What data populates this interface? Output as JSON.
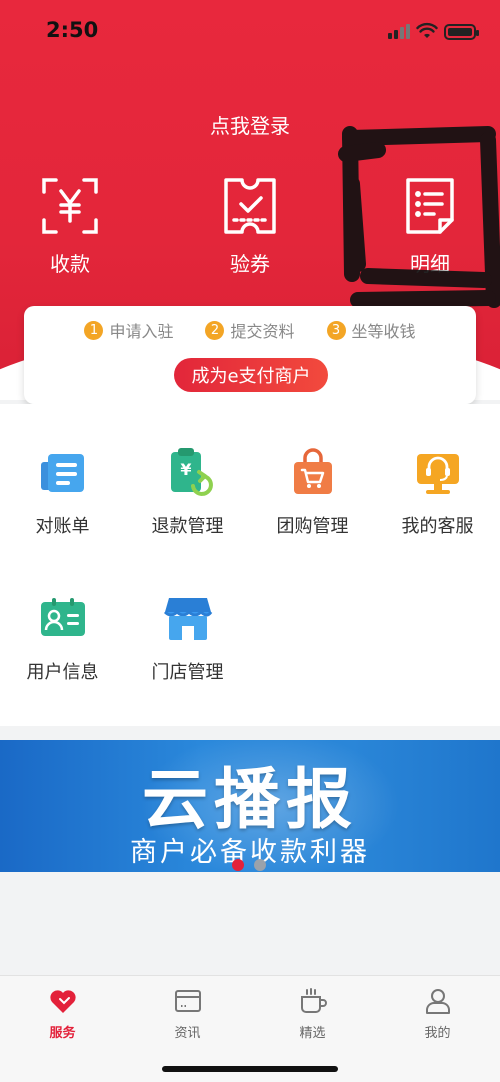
{
  "status_bar": {
    "time": "2:50"
  },
  "header": {
    "login_text": "点我登录"
  },
  "quick_actions": [
    {
      "label": "收款",
      "icon": "yen-scan-icon"
    },
    {
      "label": "验券",
      "icon": "ticket-check-icon"
    },
    {
      "label": "明细",
      "icon": "list-detail-icon"
    }
  ],
  "onboarding": {
    "steps": [
      {
        "num": "1",
        "label": "申请入驻"
      },
      {
        "num": "2",
        "label": "提交资料"
      },
      {
        "num": "3",
        "label": "坐等收钱"
      }
    ],
    "cta_label": "成为e支付商户"
  },
  "services": [
    {
      "label": "对账单",
      "icon": "statement-icon"
    },
    {
      "label": "退款管理",
      "icon": "refund-icon"
    },
    {
      "label": "团购管理",
      "icon": "shopping-bag-icon"
    },
    {
      "label": "我的客服",
      "icon": "customer-service-icon"
    },
    {
      "label": "用户信息",
      "icon": "user-card-icon"
    },
    {
      "label": "门店管理",
      "icon": "store-icon"
    }
  ],
  "banner": {
    "title": "云播报",
    "subtitle": "商户必备收款利器",
    "active_dot": 1,
    "dot_count": 2
  },
  "tab_bar": [
    {
      "label": "服务",
      "icon": "heart-icon",
      "active": true
    },
    {
      "label": "资讯",
      "icon": "news-card-icon",
      "active": false
    },
    {
      "label": "精选",
      "icon": "cup-icon",
      "active": false
    },
    {
      "label": "我的",
      "icon": "person-icon",
      "active": false
    }
  ],
  "colors": {
    "brand_red": "#e3263a",
    "step_orange": "#f3a525",
    "banner_blue": "#2a86d8"
  }
}
